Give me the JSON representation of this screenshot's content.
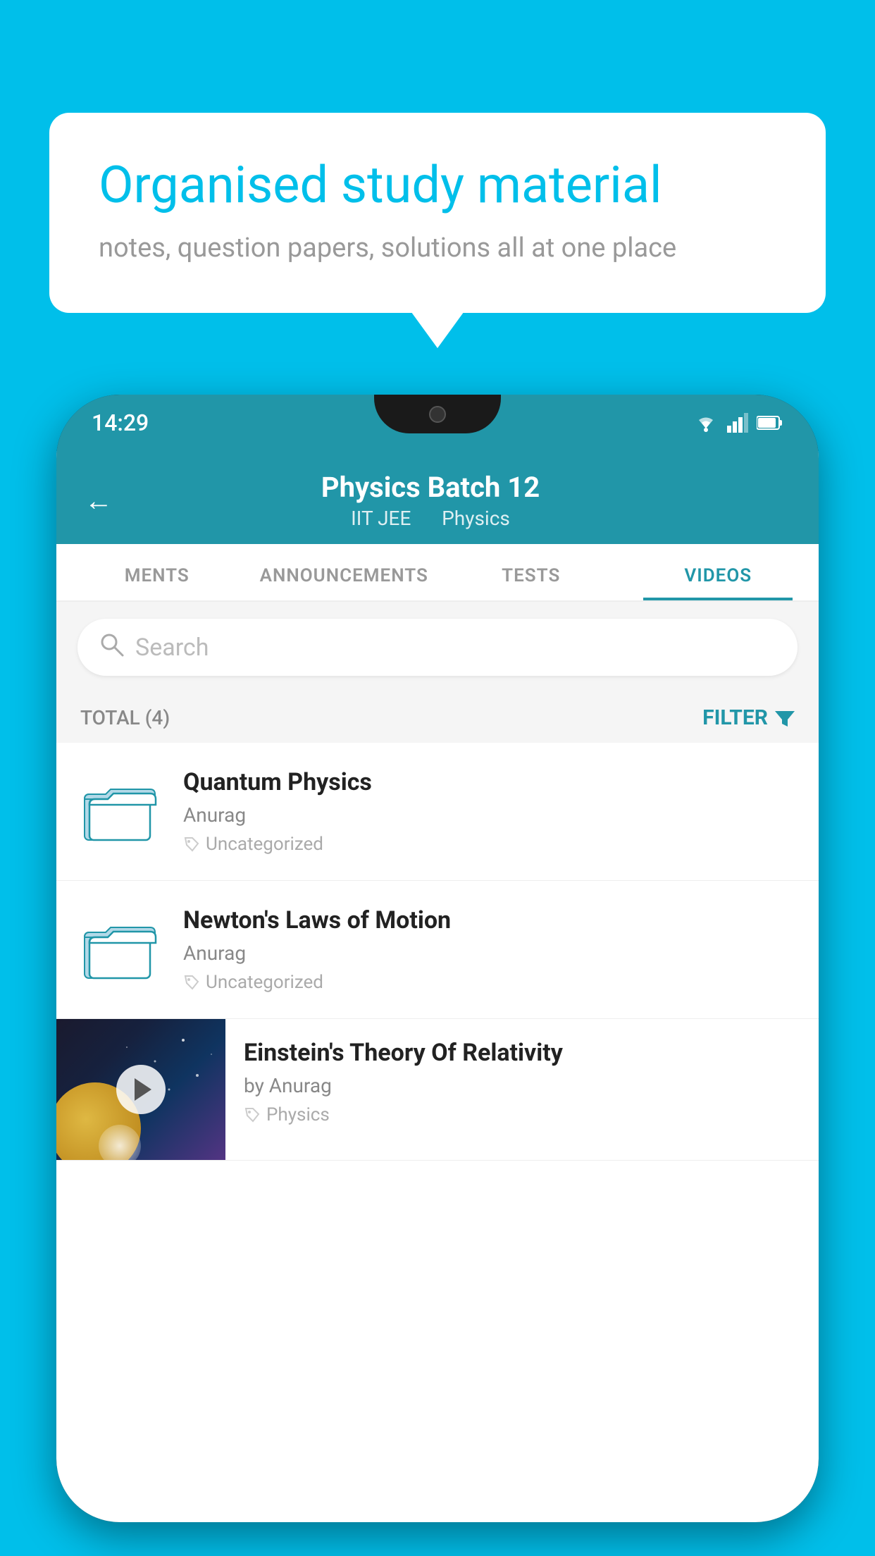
{
  "background_color": "#00BFEA",
  "speech_bubble": {
    "title": "Organised study material",
    "subtitle": "notes, question papers, solutions all at one place"
  },
  "phone": {
    "status_bar": {
      "time": "14:29"
    },
    "header": {
      "back_label": "←",
      "title": "Physics Batch 12",
      "tag1": "IIT JEE",
      "tag2": "Physics"
    },
    "tabs": [
      {
        "label": "MENTS",
        "active": false
      },
      {
        "label": "ANNOUNCEMENTS",
        "active": false
      },
      {
        "label": "TESTS",
        "active": false
      },
      {
        "label": "VIDEOS",
        "active": true
      }
    ],
    "search": {
      "placeholder": "Search"
    },
    "filter_bar": {
      "total_label": "TOTAL (4)",
      "filter_label": "FILTER"
    },
    "videos": [
      {
        "title": "Quantum Physics",
        "author": "Anurag",
        "tag": "Uncategorized",
        "type": "folder"
      },
      {
        "title": "Newton's Laws of Motion",
        "author": "Anurag",
        "tag": "Uncategorized",
        "type": "folder"
      },
      {
        "title": "Einstein's Theory Of Relativity",
        "author": "by Anurag",
        "tag": "Physics",
        "type": "video"
      }
    ]
  }
}
